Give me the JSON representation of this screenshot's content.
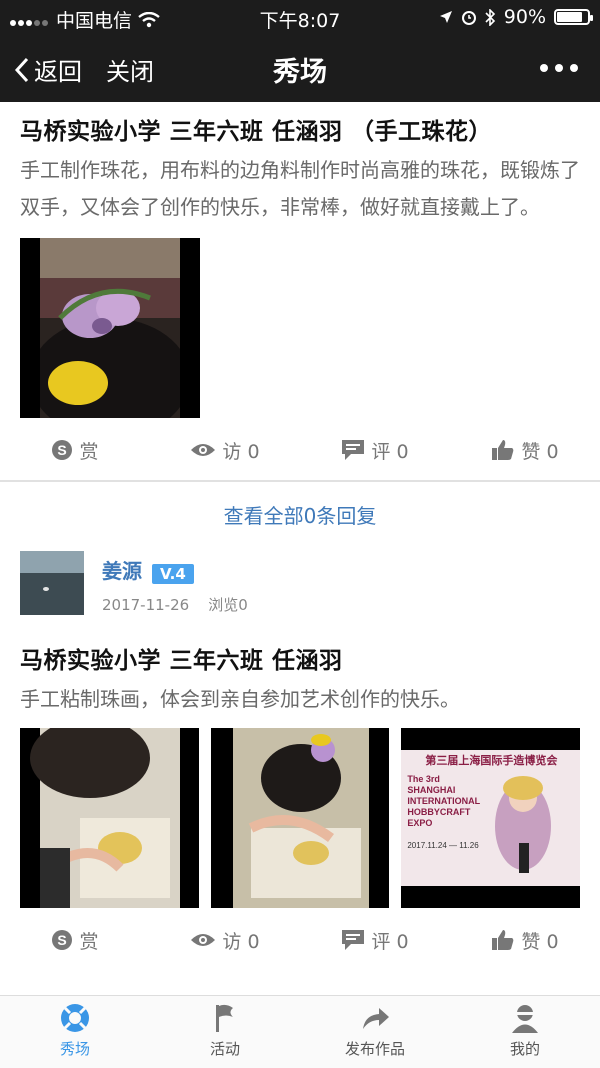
{
  "status": {
    "carrier": "中国电信",
    "time": "下午8:07",
    "battery": "90%",
    "battery_level": 0.9
  },
  "nav": {
    "back_label": "返回",
    "close_label": "关闭",
    "title": "秀场"
  },
  "post1": {
    "title": "马桥实验小学 三年六班 任涵羽 （手工珠花）",
    "description": "手工制作珠花，用布料的边角料制作时尚高雅的珠花，既锻炼了双手，又体会了创作的快乐，非常棒，做好就直接戴上了。",
    "actions": {
      "reward": "赏",
      "visits": "访 0",
      "comments": "评 0",
      "likes": "赞 0"
    },
    "view_all": "查看全部0条回复"
  },
  "post2": {
    "author": {
      "name": "姜源",
      "level": "V.4",
      "date": "2017-11-26",
      "views": "浏览0"
    },
    "title": "马桥实验小学 三年六班 任涵羽",
    "description": "手工粘制珠画，体会到亲自参加艺术创作的快乐。",
    "poster_lines": [
      "第三届上海国际手造博览会",
      "The 3rd",
      "SHANGHAI",
      "INTERNATIONAL",
      "HOBBYCRAFT",
      "EXPO",
      "2017.11.24 — 11.26"
    ],
    "actions": {
      "reward": "赏",
      "visits": "访 0",
      "comments": "评 0",
      "likes": "赞 0"
    }
  },
  "tabbar": [
    {
      "label": "秀场",
      "icon": "lifebuoy-icon",
      "active": true
    },
    {
      "label": "活动",
      "icon": "flag-icon",
      "active": false
    },
    {
      "label": "发布作品",
      "icon": "share-arrow-icon",
      "active": false
    },
    {
      "label": "我的",
      "icon": "user-icon",
      "active": false
    }
  ],
  "colors": {
    "accent": "#3a96e6",
    "link": "#3f79b9",
    "bar": "#1c1c1c"
  }
}
